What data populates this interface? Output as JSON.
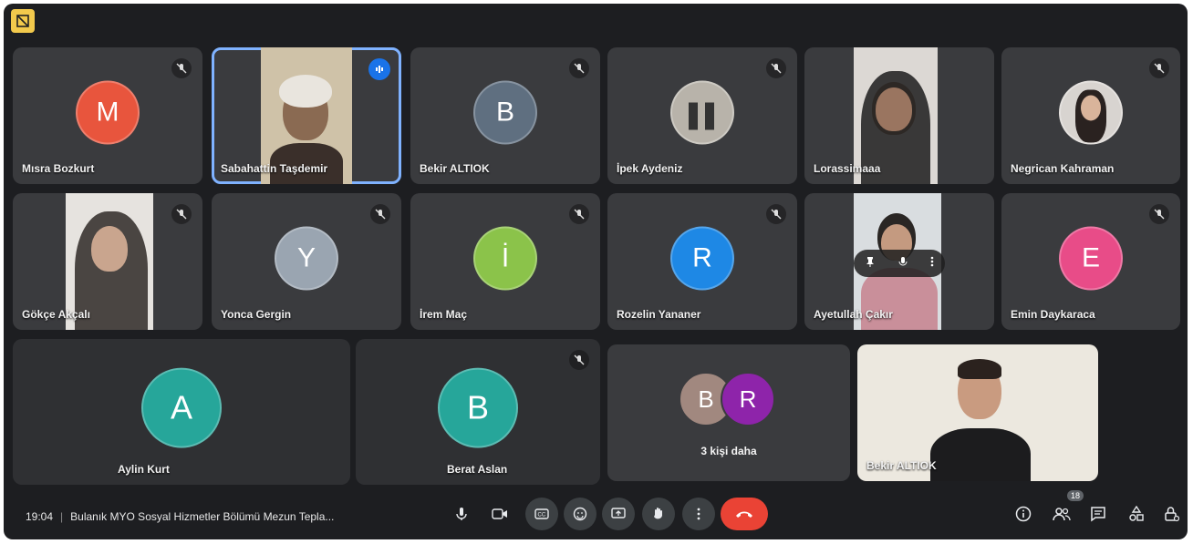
{
  "tiles": [
    {
      "name": "Mısra Bozkurt",
      "initial": "M",
      "color": "#e8553d"
    },
    {
      "name": "Sabahattin Taşdemir"
    },
    {
      "name": "Bekir ALTIOK",
      "initial": "B",
      "color": "#5f6f80"
    },
    {
      "name": "İpek Aydeniz"
    },
    {
      "name": "Lorassimaaa"
    },
    {
      "name": "Negrican Kahraman"
    },
    {
      "name": "Gökçe Akçalı"
    },
    {
      "name": "Yonca Gergin",
      "initial": "Y",
      "color": "#9aa5b1"
    },
    {
      "name": "İrem Maç",
      "initial": "İ",
      "color": "#8bc34a"
    },
    {
      "name": "Rozelin Yananer",
      "initial": "R",
      "color": "#1e88e5"
    },
    {
      "name": "Ayetullah Çakır"
    },
    {
      "name": "Emin Daykaraca",
      "initial": "E",
      "color": "#e84c88"
    },
    {
      "name": "Aylin Kurt",
      "initial": "A",
      "color": "#26a69a"
    },
    {
      "name": "Berat Aslan",
      "initial": "B",
      "color": "#26a69a"
    },
    {
      "name": "Bekir ALTIOK"
    }
  ],
  "more": {
    "label": "3 kişi daha",
    "avatars": [
      {
        "initial": "B",
        "color": "#a1887f"
      },
      {
        "initial": "R",
        "color": "#8e24aa"
      }
    ]
  },
  "bottom": {
    "time": "19:04",
    "meeting": "Bulanık MYO Sosyal Hizmetler Bölümü Mezun Tepla...",
    "people_count": "18"
  }
}
